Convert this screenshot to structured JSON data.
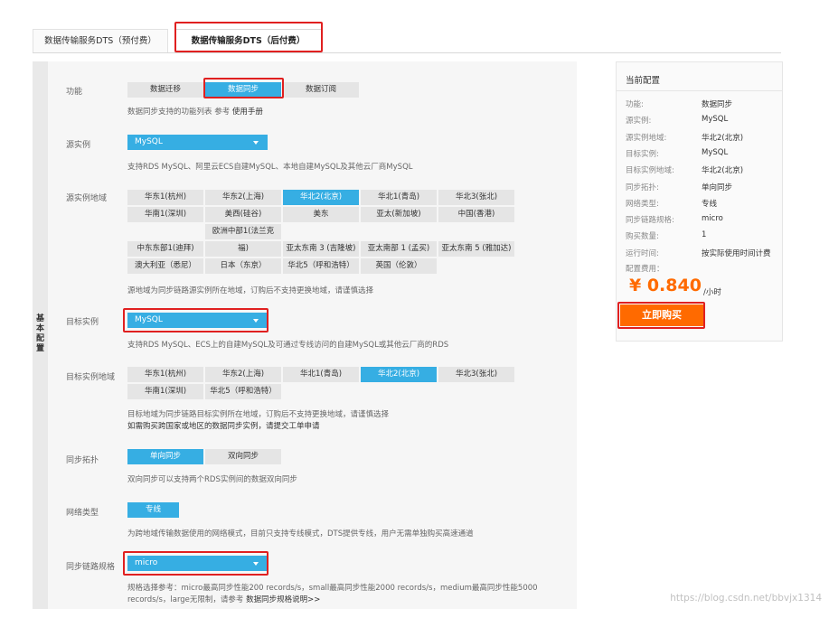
{
  "tabs": [
    {
      "label": "数据传输服务DTS（预付费）"
    },
    {
      "label": "数据传输服务DTS（后付费）"
    }
  ],
  "section_label": "基本配置",
  "rows": {
    "function": {
      "label": "功能",
      "options": [
        "数据迁移",
        "数据同步",
        "数据订阅"
      ],
      "hint": "数据同步支持的功能列表 参考",
      "hint_link": "使用手册"
    },
    "source_instance": {
      "label": "源实例",
      "value": "MySQL",
      "hint": "支持RDS MySQL、阿里云ECS自建MySQL、本地自建MySQL及其他云厂商MySQL"
    },
    "source_region": {
      "label": "源实例地域",
      "options": [
        "华东1(杭州)",
        "华东2(上海)",
        "华北2(北京)",
        "华北1(青岛)",
        "华北3(张北)",
        "华南1(深圳)",
        "美西(硅谷)",
        "美东",
        "亚太(新加坡)",
        "中国(香港)",
        "欧洲中部1(法兰克",
        "中东东部1(迪拜)",
        "福)",
        "亚太东南 3 (吉隆坡)",
        "亚太南部 1 (孟买)",
        "亚太东南 5 (雅加达)",
        "澳大利亚（悉尼）",
        "日本（东京）",
        "华北5（呼和浩特）",
        "英国（伦敦）"
      ],
      "hint": "源地域为同步链路源实例所在地域，订购后不支持更换地域，请谨慎选择"
    },
    "target_instance": {
      "label": "目标实例",
      "value": "MySQL",
      "hint": "支持RDS MySQL、ECS上的自建MySQL及可通过专线访问的自建MySQL或其他云厂商的RDS"
    },
    "target_region": {
      "label": "目标实例地域",
      "options": [
        "华东1(杭州)",
        "华东2(上海)",
        "华北1(青岛)",
        "华北2(北京)",
        "华北3(张北)",
        "华南1(深圳)",
        "华北5（呼和浩特）"
      ],
      "hint": "目标地域为同步链路目标实例所在地域，订购后不支持更换地域，请谨慎选择",
      "hint2": "如需购买跨国家或地区的数据同步实例，请提交工单申请"
    },
    "topology": {
      "label": "同步拓扑",
      "options": [
        "单向同步",
        "双向同步"
      ],
      "hint": "双向同步可以支持两个RDS实例间的数据双向同步"
    },
    "network": {
      "label": "网络类型",
      "options": [
        "专线"
      ],
      "hint": "为跨地域传输数据使用的网络模式，目前只支持专线模式，DTS提供专线，用户无需单独购买高速通道"
    },
    "spec": {
      "label": "同步链路规格",
      "value": "micro",
      "hint": "规格选择参考：micro最高同步性能200 records/s，small最高同步性能2000 records/s，medium最高同步性能5000",
      "hint2": "records/s，large无限制，请参考",
      "hint2_link": "数据同步规格说明>>"
    }
  },
  "summary": {
    "title": "当前配置",
    "items": [
      {
        "k": "功能:",
        "v": "数据同步"
      },
      {
        "k": "源实例:",
        "v": "MySQL"
      },
      {
        "k": "源实例地域:",
        "v": "华北2(北京)"
      },
      {
        "k": "目标实例:",
        "v": "MySQL"
      },
      {
        "k": "目标实例地域:",
        "v": "华北2(北京)"
      },
      {
        "k": "同步拓扑:",
        "v": "单向同步"
      },
      {
        "k": "网络类型:",
        "v": "专线"
      },
      {
        "k": "同步链路规格:",
        "v": "micro"
      },
      {
        "k": "购买数量:",
        "v": "1"
      },
      {
        "k": "运行时间:",
        "v": "按实际使用时间计费"
      }
    ],
    "fee_label": "配置费用：",
    "price": "¥ 0.840",
    "unit": "/小时",
    "buy_label": "立即购买"
  },
  "watermark": "https://blog.csdn.net/bbvjx1314",
  "colors": {
    "accent": "#36aee3",
    "buy": "#ff6a00",
    "highlight": "#e02020"
  }
}
